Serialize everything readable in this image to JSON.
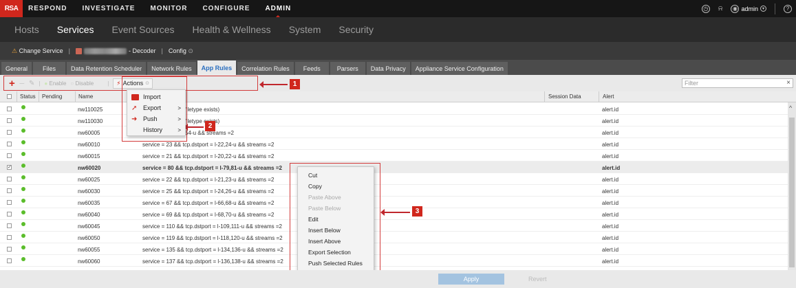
{
  "topbar": {
    "logo": "RSA",
    "nav": [
      "RESPOND",
      "INVESTIGATE",
      "MONITOR",
      "CONFIGURE",
      "ADMIN"
    ],
    "active": "ADMIN",
    "user": "admin"
  },
  "subnav": {
    "items": [
      "Hosts",
      "Services",
      "Event Sources",
      "Health & Wellness",
      "System",
      "Security"
    ],
    "active": "Services"
  },
  "servicebar": {
    "change_service": "Change Service",
    "service_name": "- Decoder",
    "config": "Config"
  },
  "tabs": {
    "items": [
      "General",
      "Files",
      "Data Retention Scheduler",
      "Network Rules",
      "App Rules",
      "Correlation Rules",
      "Feeds",
      "Parsers",
      "Data Privacy",
      "Appliance Service Configuration"
    ],
    "active": "App Rules"
  },
  "toolbar": {
    "enable": "Enable",
    "disable": "Disable",
    "actions": "Actions",
    "filter_placeholder": "Filter"
  },
  "table": {
    "headers": {
      "status": "Status",
      "pending": "Pending",
      "name": "Name",
      "session_data": "Session Data",
      "alert": "Alert"
    },
    "rows": [
      {
        "name": "nw110025",
        "rule": "filename exists || filetype exists)",
        "alert": "alert.id",
        "checked": false
      },
      {
        "name": "nw110030",
        "rule": "filename exists || filetype exists)",
        "alert": "alert.id",
        "checked": false
      },
      {
        "name": "nw60005",
        "rule": "tcp.dstport = l-52,54-u && streams =2",
        "alert": "alert.id",
        "checked": false
      },
      {
        "name": "nw60010",
        "rule": "service = 23 && tcp.dstport = l-22,24-u && streams =2",
        "alert": "alert.id",
        "checked": false
      },
      {
        "name": "nw60015",
        "rule": "service = 21 && tcp.dstport = l-20,22-u && streams =2",
        "alert": "alert.id",
        "checked": false
      },
      {
        "name": "nw60020",
        "rule": "service = 80 && tcp.dstport = l-79,81-u && streams =2",
        "alert": "alert.id",
        "checked": true
      },
      {
        "name": "nw60025",
        "rule": "service = 22 && tcp.dstport = l-21,23-u && streams =2",
        "alert": "alert.id",
        "checked": false
      },
      {
        "name": "nw60030",
        "rule": "service = 25 && tcp.dstport = l-24,26-u && streams =2",
        "alert": "alert.id",
        "checked": false
      },
      {
        "name": "nw60035",
        "rule": "service = 67 && tcp.dstport = l-66,68-u && streams =2",
        "alert": "alert.id",
        "checked": false
      },
      {
        "name": "nw60040",
        "rule": "service = 69 && tcp.dstport = l-68,70-u && streams =2",
        "alert": "alert.id",
        "checked": false
      },
      {
        "name": "nw60045",
        "rule": "service = 110 && tcp.dstport = l-109,111-u && streams =2",
        "alert": "alert.id",
        "checked": false
      },
      {
        "name": "nw60050",
        "rule": "service = 119 && tcp.dstport = l-118,120-u && streams =2",
        "alert": "alert.id",
        "checked": false
      },
      {
        "name": "nw60055",
        "rule": "service = 135 && tcp.dstport = l-134,136-u && streams =2",
        "alert": "alert.id",
        "checked": false
      },
      {
        "name": "nw60060",
        "rule": "service = 137 && tcp.dstport = l-136,138-u && streams =2",
        "alert": "alert.id",
        "checked": false
      }
    ]
  },
  "actions_menu": {
    "import": "Import",
    "export": "Export",
    "push": "Push",
    "history": "History"
  },
  "context_menu": {
    "items": [
      {
        "label": "Cut",
        "disabled": false
      },
      {
        "label": "Copy",
        "disabled": false
      },
      {
        "label": "Paste Above",
        "disabled": true
      },
      {
        "label": "Paste Below",
        "disabled": true
      },
      {
        "label": "Edit",
        "disabled": false
      },
      {
        "label": "Insert Below",
        "disabled": false
      },
      {
        "label": "Insert Above",
        "disabled": false
      },
      {
        "label": "Export Selection",
        "disabled": false
      },
      {
        "label": "Push Selected Rules",
        "disabled": false
      }
    ]
  },
  "callouts": [
    "1",
    "2",
    "3"
  ],
  "footer": {
    "apply": "Apply",
    "revert": "Revert"
  },
  "colors": {
    "accent": "#d0271d",
    "status_green": "#5bbd2b",
    "tab_active": "#2b6fbf",
    "apply_btn": "#a3c3e0"
  }
}
